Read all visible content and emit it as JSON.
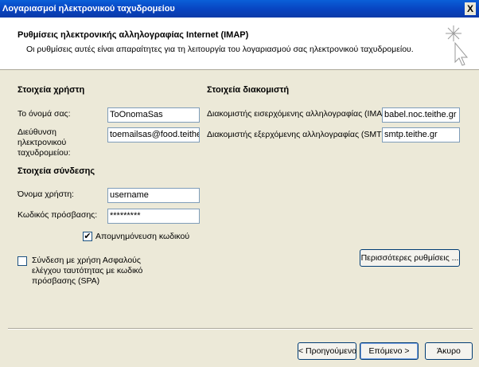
{
  "window": {
    "title": "Λογαριασμοί ηλεκτρονικού ταχυδρομείου",
    "close_glyph": "X"
  },
  "header": {
    "title": "Ρυθμίσεις ηλεκτρονικής αλληλογραφίας Internet (IMAP)",
    "subtitle": "Οι ρυθμίσεις αυτές είναι απαραίτητες για τη λειτουργία του λογαριασμού σας ηλεκτρονικού ταχυδρομείου.",
    "icon": "wizard-sparkle-icon"
  },
  "user_info": {
    "title": "Στοιχεία χρήστη",
    "name_label": "Το όνομά σας:",
    "name_value": "ToOnomaSas",
    "email_label": "Διεύθυνση ηλεκτρονικού ταχυδρομείου:",
    "email_value": "toemailsas@food.teithe.gr"
  },
  "server_info": {
    "title": "Στοιχεία διακομιστή",
    "incoming_label": "Διακομιστής εισερχόμενης αλληλογραφίας (IMAP):",
    "incoming_value": "babel.noc.teithe.gr",
    "outgoing_label": "Διακομιστής εξερχόμενης αλληλογραφίας (SMTP):",
    "outgoing_value": "smtp.teithe.gr"
  },
  "login_info": {
    "title": "Στοιχεία σύνδεσης",
    "username_label": "Όνομα χρήστη:",
    "username_value": "username",
    "password_label": "Κωδικός πρόσβασης:",
    "password_value": "*********",
    "remember_label": "Απομνημόνευση κωδικού",
    "remember_checked": true,
    "check_glyph": "✔"
  },
  "spa": {
    "label": "Σύνδεση με χρήση Ασφαλούς ελέγχου ταυτότητας με κωδικό πρόσβασης (SPA)",
    "checked": false
  },
  "more_settings_label": "Περισσότερες ρυθμίσεις ...",
  "footer": {
    "back_label": "< Προηγούμενο",
    "next_label": "Επόμενο >",
    "cancel_label": "Άκυρο"
  }
}
